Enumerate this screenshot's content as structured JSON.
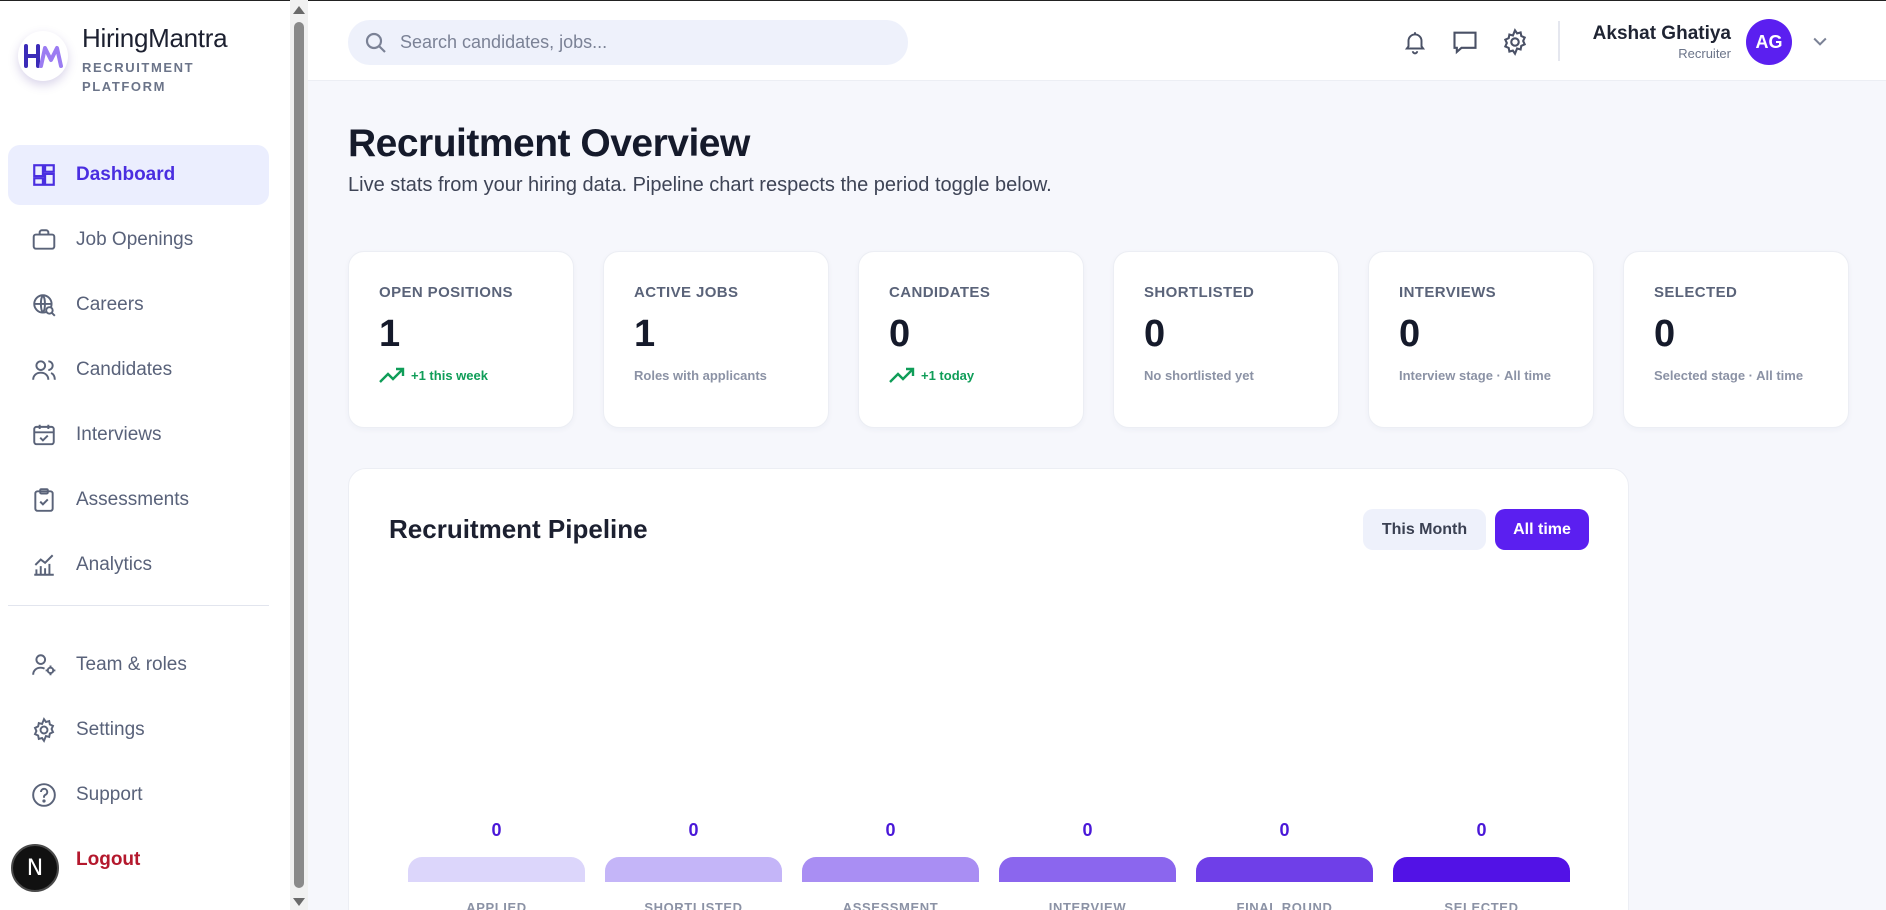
{
  "brand": {
    "name": "HiringMantra",
    "subtitle": "RECRUITMENT PLATFORM",
    "logo_text": "HM"
  },
  "sidebar": {
    "items": [
      {
        "label": "Dashboard",
        "icon": "dashboard-icon",
        "active": true
      },
      {
        "label": "Job Openings",
        "icon": "briefcase-icon"
      },
      {
        "label": "Careers",
        "icon": "globe-search-icon"
      },
      {
        "label": "Candidates",
        "icon": "users-icon"
      },
      {
        "label": "Interviews",
        "icon": "calendar-check-icon"
      },
      {
        "label": "Assessments",
        "icon": "clipboard-check-icon"
      },
      {
        "label": "Analytics",
        "icon": "analytics-icon"
      }
    ],
    "secondary": [
      {
        "label": "Team & roles",
        "icon": "user-gear-icon"
      },
      {
        "label": "Settings",
        "icon": "gear-icon"
      },
      {
        "label": "Support",
        "icon": "help-icon"
      },
      {
        "label": "Logout",
        "icon": "logout-icon"
      }
    ],
    "next_badge": "N"
  },
  "topbar": {
    "search_placeholder": "Search candidates, jobs...",
    "user_name": "Akshat Ghatiya",
    "user_role": "Recruiter",
    "user_initials": "AG"
  },
  "main": {
    "title": "Recruitment Overview",
    "subtitle": "Live stats from your hiring data. Pipeline chart respects the period toggle below.",
    "stats": [
      {
        "label": "OPEN POSITIONS",
        "value": "1",
        "trend": "+1 this week"
      },
      {
        "label": "ACTIVE JOBS",
        "value": "1",
        "note": "Roles with applicants"
      },
      {
        "label": "CANDIDATES",
        "value": "0",
        "trend": "+1 today"
      },
      {
        "label": "SHORTLISTED",
        "value": "0",
        "note": "No shortlisted yet"
      },
      {
        "label": "INTERVIEWS",
        "value": "0",
        "note": "Interview stage · All time"
      },
      {
        "label": "SELECTED",
        "value": "0",
        "note": "Selected stage · All time"
      }
    ],
    "pipeline": {
      "title": "Recruitment Pipeline",
      "toggle_month": "This Month",
      "toggle_all": "All time",
      "selected_period": "All time"
    }
  },
  "chart_data": {
    "type": "bar",
    "title": "Recruitment Pipeline",
    "categories": [
      "APPLIED",
      "SHORTLISTED",
      "ASSESSMENT",
      "INTERVIEW",
      "FINAL ROUND",
      "SELECTED"
    ],
    "values": [
      0,
      0,
      0,
      0,
      0,
      0
    ],
    "colors": [
      "#dcd6fb",
      "#c4b5f8",
      "#a98ef3",
      "#8b66ee",
      "#6f3fe8",
      "#5212e6"
    ]
  }
}
